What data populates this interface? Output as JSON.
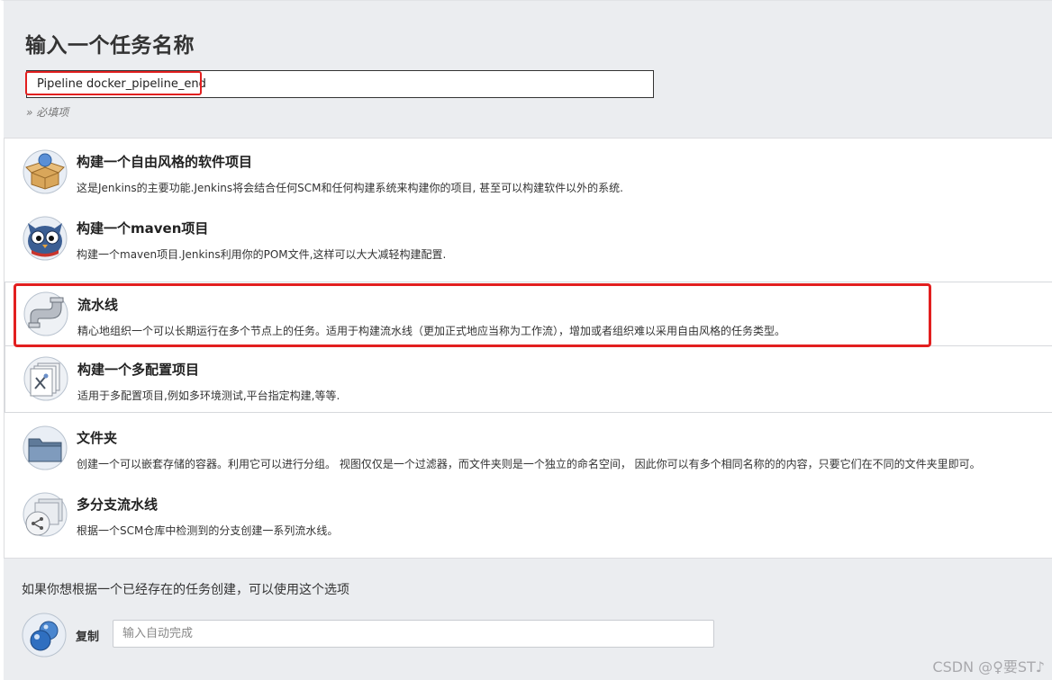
{
  "header": {
    "title": "输入一个任务名称",
    "name_value": "Pipeline docker_pipeline_end",
    "required_note": "» 必填项"
  },
  "items": [
    {
      "label": "构建一个自由风格的软件项目",
      "desc": "这是Jenkins的主要功能.Jenkins将会结合任何SCM和任何构建系统来构建你的项目, 甚至可以构建软件以外的系统.",
      "icon": "freestyle-box-icon"
    },
    {
      "label": "构建一个maven项目",
      "desc": "构建一个maven项目.Jenkins利用你的POM文件,这样可以大大减轻构建配置.",
      "icon": "maven-owl-icon"
    },
    {
      "label": "流水线",
      "desc": "精心地组织一个可以长期运行在多个节点上的任务。适用于构建流水线（更加正式地应当称为工作流），增加或者组织难以采用自由风格的任务类型。",
      "icon": "pipeline-pipe-icon"
    },
    {
      "label": "构建一个多配置项目",
      "desc": "适用于多配置项目,例如多环境测试,平台指定构建,等等.",
      "icon": "multi-config-icon"
    },
    {
      "label": "文件夹",
      "desc": "创建一个可以嵌套存储的容器。利用它可以进行分组。 视图仅仅是一个过滤器，而文件夹则是一个独立的命名空间， 因此你可以有多个相同名称的的内容，只要它们在不同的文件夹里即可。",
      "icon": "folder-icon"
    },
    {
      "label": "多分支流水线",
      "desc": "根据一个SCM仓库中检测到的分支创建一系列流水线。",
      "icon": "multibranch-icon"
    }
  ],
  "copy_section": {
    "hint": "如果你想根据一个已经存在的任务创建，可以使用这个选项",
    "label": "复制",
    "placeholder": "输入自动完成"
  },
  "watermark": "CSDN @♀要ST♪",
  "colors": {
    "highlight": "#e21f1f",
    "panel_bg": "#ebedf0"
  }
}
